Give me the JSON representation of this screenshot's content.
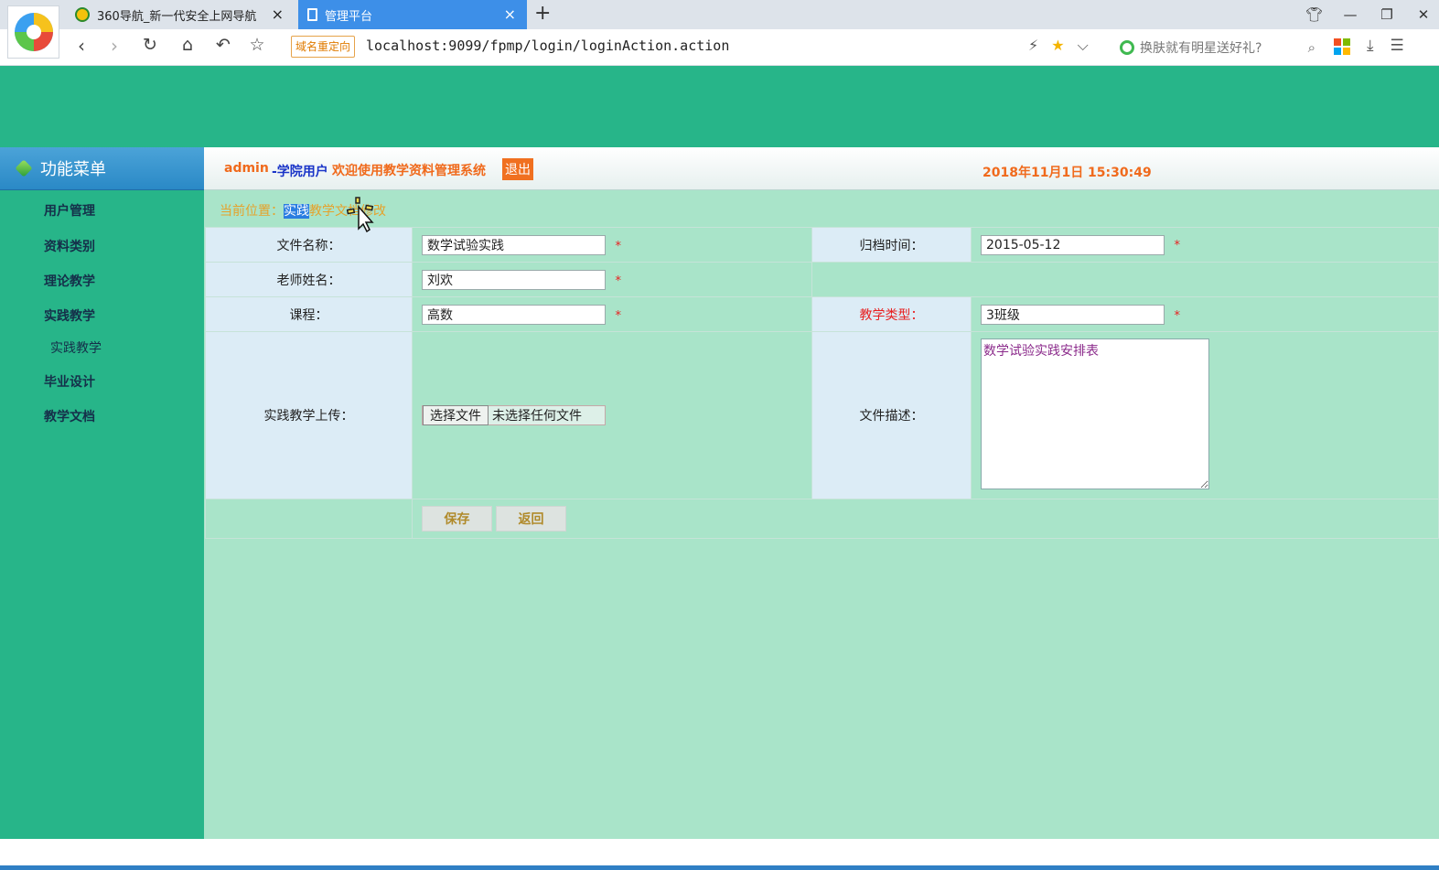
{
  "browser": {
    "tabs": [
      {
        "title": "360导航_新一代安全上网导航",
        "close": "×"
      },
      {
        "title": "管理平台",
        "close": "×"
      }
    ],
    "new_tab": "+",
    "redirect_badge": "域名重定向",
    "url": "localhost:9099/fpmp/login/loginAction.action",
    "search_placeholder": "换肤就有明星送好礼?"
  },
  "sidebar": {
    "title": "功能菜单",
    "items": [
      {
        "label": "用户管理"
      },
      {
        "label": "资料类别"
      },
      {
        "label": "理论教学"
      },
      {
        "label": "实践教学"
      },
      {
        "label": "实践教学",
        "sub": true
      },
      {
        "label": "毕业设计"
      },
      {
        "label": "教学文档"
      }
    ]
  },
  "header": {
    "user": "admin",
    "role": "-学院用户",
    "welcome": "欢迎使用教学资料管理系统",
    "logout": "退出",
    "datetime": "2018年11月1日 15:30:49"
  },
  "breadcrumb": {
    "prefix": "当前位置：",
    "highlight": "实践",
    "rest": "教学文档修改"
  },
  "form": {
    "file_name_label": "文件名称：",
    "file_name_value": "数学试验实践",
    "archive_time_label": "归档时间：",
    "archive_time_value": "2015-05-12",
    "teacher_label": "老师姓名：",
    "teacher_value": "刘欢",
    "course_label": "课程：",
    "course_value": "高数",
    "teach_type_label": "教学类型：",
    "teach_type_value": "3班级",
    "upload_label": "实践教学上传：",
    "choose_file": "选择文件",
    "no_file": "未选择任何文件",
    "desc_label": "文件描述：",
    "desc_value": "数学试验实践安排表",
    "required": "*",
    "save": "保存",
    "back": "返回"
  }
}
